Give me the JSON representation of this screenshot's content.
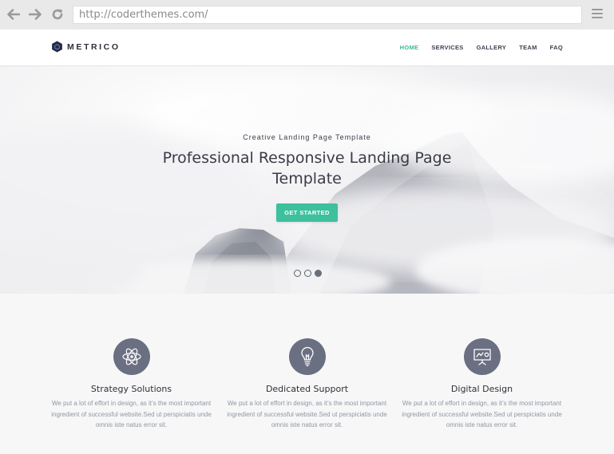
{
  "browser": {
    "url": "http://coderthemes.com/",
    "back_icon": "arrow-left-icon",
    "forward_icon": "arrow-right-icon",
    "reload_icon": "reload-icon",
    "menu_icon": "hamburger-menu-icon"
  },
  "site": {
    "logo_text": "METRICO",
    "nav": [
      {
        "label": "HOME",
        "active": true
      },
      {
        "label": "SERVICES",
        "active": false
      },
      {
        "label": "GALLERY",
        "active": false
      },
      {
        "label": "TEAM",
        "active": false
      },
      {
        "label": "FAQ",
        "active": false
      }
    ]
  },
  "hero": {
    "kicker": "Creative Landing Page Template",
    "title": "Professional Responsive Landing Page Template",
    "cta_label": "GET STARTED",
    "slides": 3,
    "active_slide": 3
  },
  "features": [
    {
      "icon": "atom-icon",
      "title": "Strategy Solutions",
      "text": "We put a lot of effort in design, as it’s the most important ingredient of successful website.Sed ut perspiciatis unde omnis iste natus error sit."
    },
    {
      "icon": "lightbulb-icon",
      "title": "Dedicated Support",
      "text": "We put a lot of effort in design, as it’s the most important ingredient of successful website.Sed ut perspiciatis unde omnis iste natus error sit."
    },
    {
      "icon": "presentation-board-icon",
      "title": "Digital Design",
      "text": "We put a lot of effort in design, as it’s the most important ingredient of successful website.Sed ut perspiciatis unde omnis iste natus error sit."
    }
  ],
  "colors": {
    "accent": "#3cc09e",
    "nav_active": "#3cb99a",
    "icon_circle": "#6a6f82",
    "chrome": "#e9e9ea"
  }
}
